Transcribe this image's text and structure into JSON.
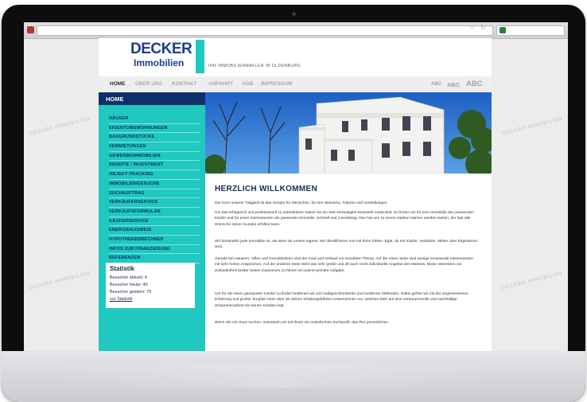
{
  "colors": {
    "brand_navy": "#0f2f6b",
    "brand_teal": "#1fc9bf",
    "logo_blue": "#1f3d8f"
  },
  "browser": {
    "star_icon": "star-icon",
    "reload_icon": "reload-icon"
  },
  "watermark": {
    "text": "DECKER IMMOBILIEN"
  },
  "header": {
    "logo_line1": "DECKER",
    "logo_line2": "Immobilien",
    "tagline": "IHR IMMOBILIENMAKLER IN OLDENBURG"
  },
  "topnav": {
    "items": [
      {
        "label": "HOME",
        "active": true
      },
      {
        "label": "ÜBER UNS",
        "active": false
      },
      {
        "label": "KONTAKT",
        "active": false
      },
      {
        "label": "ANFAHRT",
        "active": false
      },
      {
        "label": "AGB",
        "active": false
      },
      {
        "label": "IMPRESSUM",
        "active": false
      }
    ],
    "font_size_options": [
      "ABC",
      "ABC",
      "ABC"
    ]
  },
  "sidebar": {
    "home_label": "HOME",
    "items": [
      "HÄUSER",
      "EIGENTUMSWOHNUNGEN",
      "BAUGRUNDSTÜCKE",
      "VERMIETUNGEN",
      "GEWERBEIMMOBILIEN",
      "RENDITE / INVESTMENT",
      "OBJEKT-TRACKING",
      "IMMOBILIENGESUCHE",
      "SUCHAUFTRAG",
      "VERKÄUFERSERVICE",
      "VERKAUFSFORMULAR",
      "KÄUFERSERVICE",
      "ENERGIEAUSWEIS",
      "HYPOTHEKENRECHNER",
      "INFOS ZUR FINANZIERUNG",
      "REFERENZEN"
    ],
    "stats": {
      "title": "Statistik",
      "current": "Besucher aktuell: 4",
      "today": "Besucher heute: 40",
      "yesterday": "Besucher gestern: 79",
      "link": "zur Statistik"
    }
  },
  "content": {
    "heading": "HERZLICH WILLKOMMEN",
    "paragraphs": [
      "Der Kern unserer Tätigkeit ist das Gespür für Menschen, für ihre Wünsche, Träume und Vorstellungen.",
      "Um das erfolgreich und professionell zu unterstützen haben wir ein weit verzweigtes Netzwerk entwickelt. So finden wir für eine Immobilie den passenden Käufer und für einen Interessenten die passende Immobilie. Schnell und zuverlässig. Das hat uns zu einem starken Namen werden lassen, der fast alle Wünsche seiner Kunden erfüllen kann.",
      "Wir behandeln jede Immobilie so, als wäre sie unsere eigene. Wir identifizieren uns mit Ihren Zielen. Egal, ob Sie Käufer, Verkäufer, Mieter oder Eigentümer sind.",
      "Gerade bei Häusern, Villen und Grundstücken sind der Kauf und Verkauf ein sensibles Thema. Auf der einen Seite sind wenige emotionale Interessenten mit sehr hohen Ansprüchen. Auf der anderen Seite steht das sehr große und oft auch recht individuelle Angebot des Marktes. Diese Interessen zur Zufriedenheit beider Seiten zusammen zu führen ist unsere primäre Aufgabe.",
      "Um für Sie einen geeigneten Käufer zu finden bedienen wir uns maßgeschneiderter und moderner Methoden. Dabei gehen wir mit der angemessenen Erfahrung und großer Sorgfalt eines über 30 Jahren inhabergeführten Unternehmen vor, welches Wert auf eine vertrauensvolle und nachhaltige Zusammenarbeit mit seinen Kunden legt.",
      "Wenn Sie ein Haus suchen, entwickeln wir mit Ihnen ein realistisches Suchprofil, das Ihre persönlichen"
    ]
  }
}
